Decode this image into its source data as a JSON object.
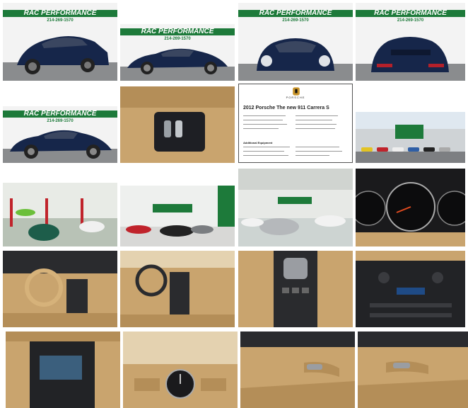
{
  "gallery": {
    "dealer": {
      "name": "RAC PERFORMANCE",
      "phone": "214-269-1570"
    },
    "sticker": {
      "title": "2012 Porsche The new 911 Carrera S",
      "brand": "PORSCHE",
      "section": "Additional Equipment"
    },
    "colors": {
      "brand_green": "#1d7a3a",
      "paint_blue": "#16264a",
      "interior_tan": "#c9a46e",
      "floor_grey": "#8a8c8e"
    },
    "thumbnails": [
      "front-three-quarter",
      "side-profile",
      "front",
      "rear",
      "side-profile-2",
      "key-and-manual",
      "window-sticker",
      "showroom-exterior",
      "service-shop",
      "showroom-floor",
      "showroom-floor-2",
      "gauge-cluster",
      "driver-cockpit",
      "dashboard",
      "center-console",
      "climate-controls",
      "infotainment",
      "dash-clock",
      "door-panel",
      "door-panel-2"
    ]
  }
}
